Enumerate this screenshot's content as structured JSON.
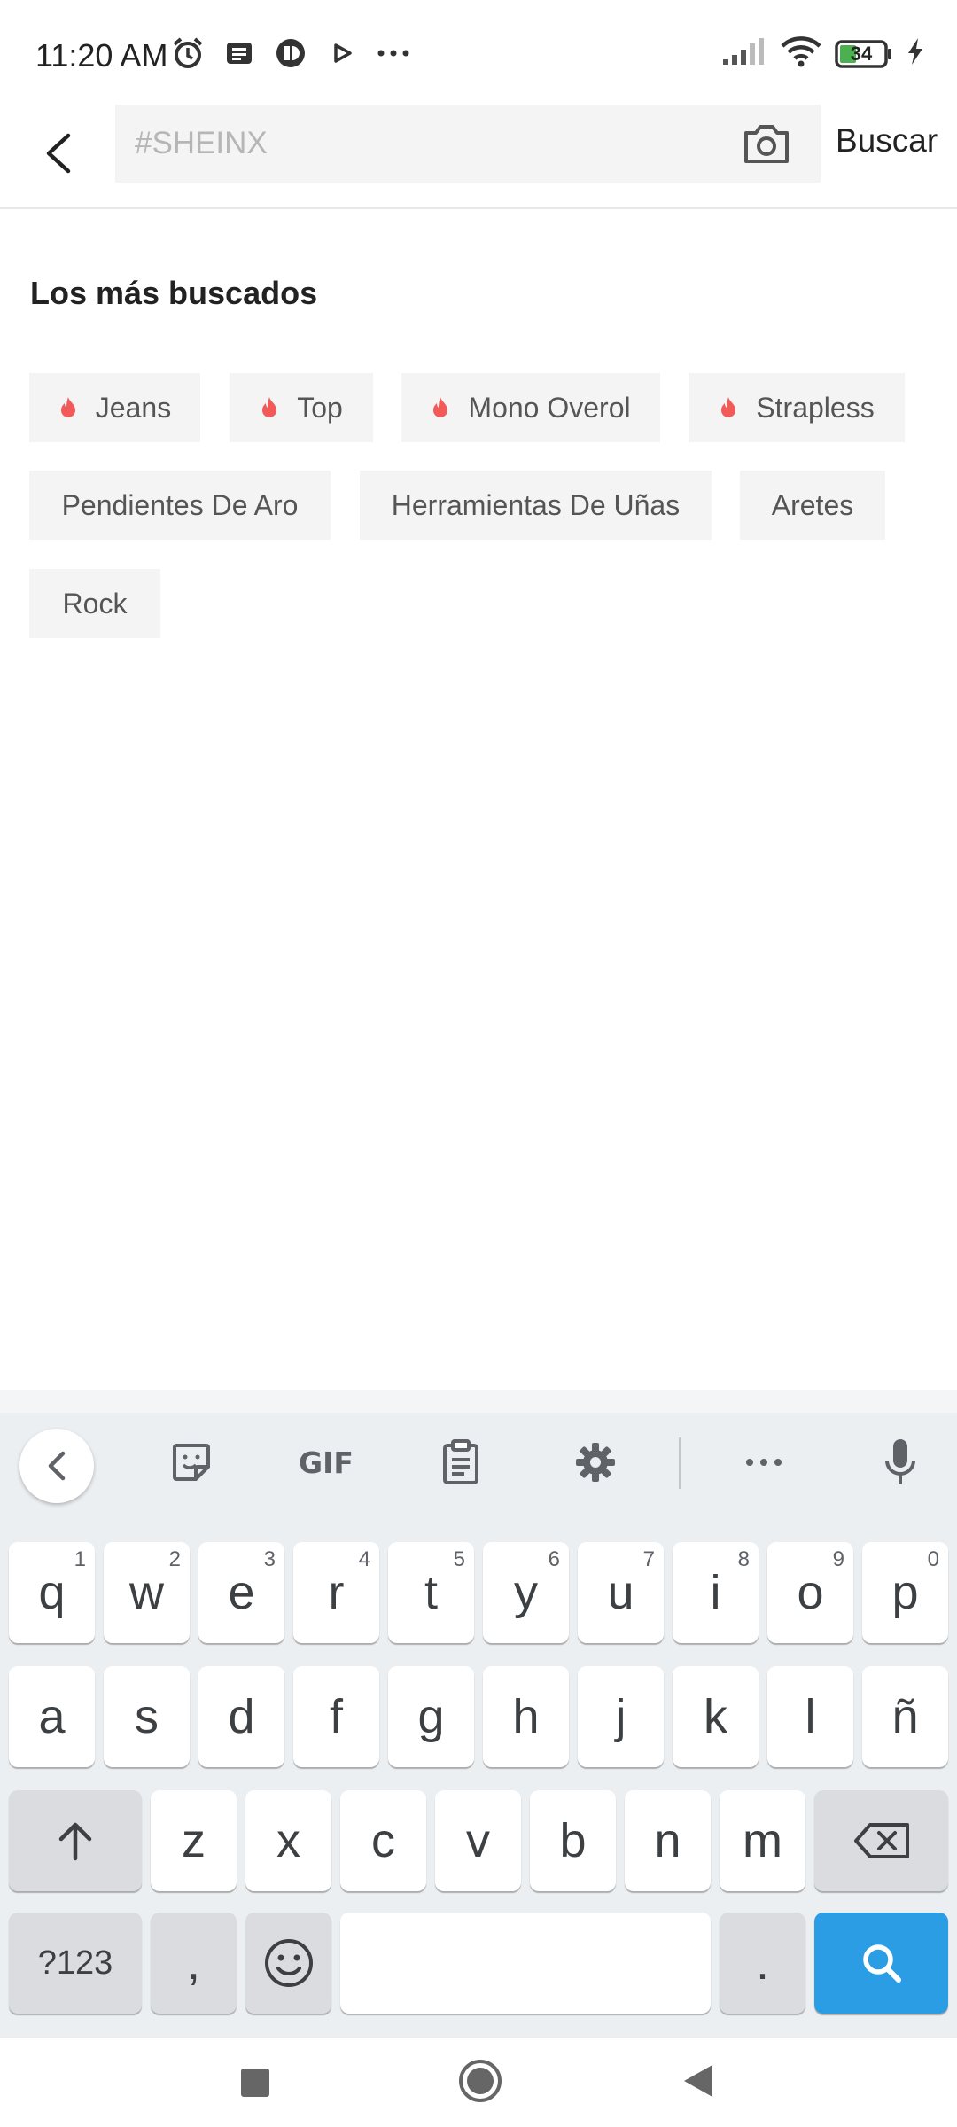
{
  "status_bar": {
    "time": "11:20 AM",
    "battery": "34",
    "left_icons": [
      "alarm-icon",
      "news-icon",
      "app-icon",
      "play-icon",
      "more-dots-icon"
    ],
    "right_icons": [
      "signal-icon",
      "wifi-icon",
      "battery-icon",
      "charging-icon"
    ]
  },
  "search": {
    "placeholder": "#SHEINX",
    "value": "",
    "submit_label": "Buscar"
  },
  "trending": {
    "title": "Los más buscados",
    "chips": [
      {
        "label": "Jeans",
        "hot": true
      },
      {
        "label": "Top",
        "hot": true
      },
      {
        "label": "Mono Overol",
        "hot": true
      },
      {
        "label": "Strapless",
        "hot": true
      },
      {
        "label": "Pendientes De Aro",
        "hot": false
      },
      {
        "label": "Herramientas De Uñas",
        "hot": false
      },
      {
        "label": "Aretes",
        "hot": false
      },
      {
        "label": "Rock",
        "hot": false
      }
    ]
  },
  "keyboard": {
    "toolbar": {
      "gif_label": "GIF"
    },
    "row1": [
      {
        "k": "q",
        "h": "1"
      },
      {
        "k": "w",
        "h": "2"
      },
      {
        "k": "e",
        "h": "3"
      },
      {
        "k": "r",
        "h": "4"
      },
      {
        "k": "t",
        "h": "5"
      },
      {
        "k": "y",
        "h": "6"
      },
      {
        "k": "u",
        "h": "7"
      },
      {
        "k": "i",
        "h": "8"
      },
      {
        "k": "o",
        "h": "9"
      },
      {
        "k": "p",
        "h": "0"
      }
    ],
    "row2": [
      "a",
      "s",
      "d",
      "f",
      "g",
      "h",
      "j",
      "k",
      "l",
      "ñ"
    ],
    "row3": [
      "z",
      "x",
      "c",
      "v",
      "b",
      "n",
      "m"
    ],
    "symbols_label": "?123",
    "comma_label": ",",
    "period_label": "."
  },
  "colors": {
    "accent_blue": "#2a9de5",
    "flame": "#f25a5a",
    "chip_bg": "#f4f4f4"
  }
}
